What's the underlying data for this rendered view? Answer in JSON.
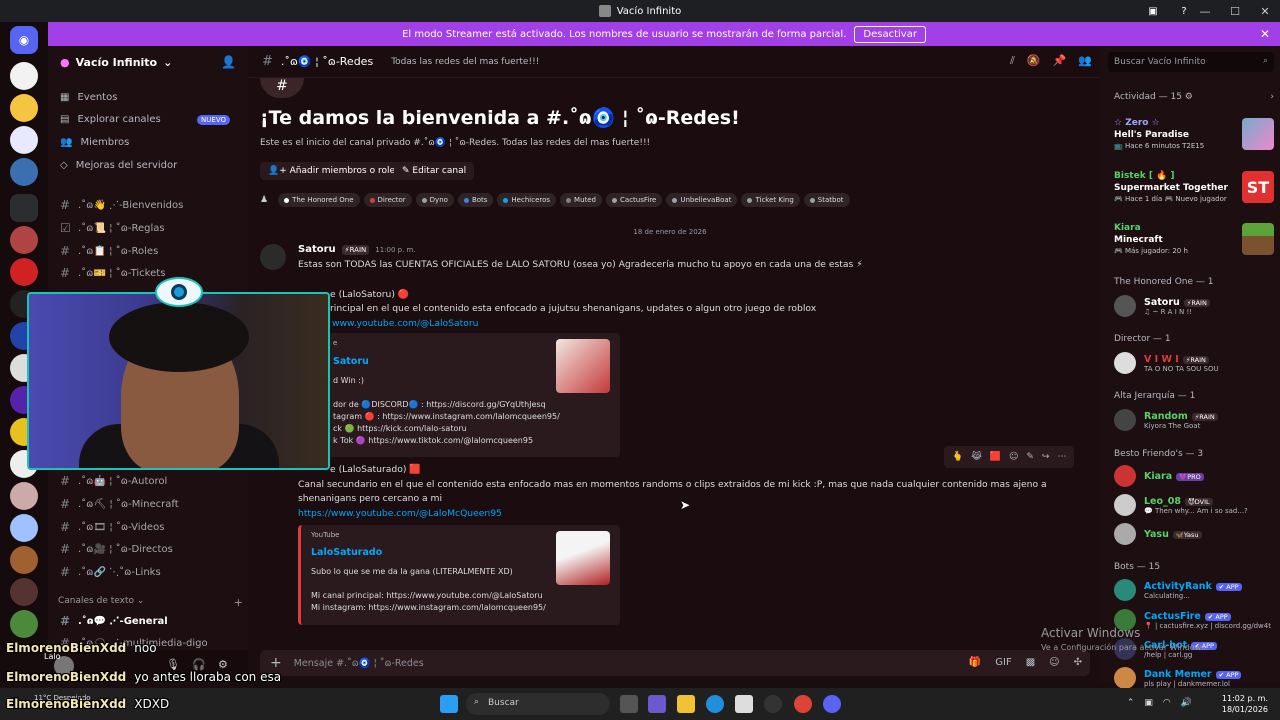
{
  "window": {
    "title": "Vacío Infinito"
  },
  "banner": {
    "text": "El modo Streamer está activado. Los nombres de usuario se mostrarán de forma parcial.",
    "button": "Desactivar"
  },
  "guild": {
    "name": "Vacío Infinito"
  },
  "nav": [
    {
      "label": "Eventos"
    },
    {
      "label": "Explorar canales",
      "badge": "NUEVO"
    },
    {
      "label": "Miembros"
    },
    {
      "label": "Mejoras del servidor"
    }
  ],
  "channels_top": [
    {
      "label": ".˚ɷ👋 ⋰-Bienvenidos"
    },
    {
      "label": ".˚ɷ📜 ¦ ˚ɷ-Reglas"
    },
    {
      "label": ".˚ɷ📋 ¦ ˚ɷ-Roles"
    },
    {
      "label": ".˚ɷ🎫 ¦ ˚ɷ-Tickets"
    }
  ],
  "channels_mid": [
    {
      "label": ".˚ɷ🤖 ¦ ˚ɷ-Autorol"
    },
    {
      "label": ".˚ɷ⛏ ¦ ˚ɷ-Minecraft"
    },
    {
      "label": ".˚ɷ🎞 ¦ ˚ɷ-Videos"
    },
    {
      "label": ".˚ɷ🎥 ¦ ˚ɷ-Directos"
    },
    {
      "label": ".˚ɷ🔗 ⋱˚ɷ-Links"
    }
  ],
  "category_text": "Canales de texto",
  "channel_general": ".˚ɷ💬 ⋰-General",
  "channel_partial": ".˚ɷ🗨 ⋰-multimiedia-digo",
  "header": {
    "channel": ".˚ɷ🧿 ¦ ˚ɷ-Redes",
    "topic": "Todas las redes del mas fuerte!!!"
  },
  "welcome": {
    "title": "¡Te damos la bienvenida a #.˚ɷ🧿 ¦ ˚ɷ-Redes!",
    "subtitle": "Este es el inicio del canal privado #.˚ɷ🧿 ¦ ˚ɷ-Redes. Todas las redes del mas fuerte!!!",
    "add_button": "Añadir miembros o roles",
    "edit_button": "Editar canal"
  },
  "roles": [
    {
      "label": "The Honored One",
      "color": "#ffffff"
    },
    {
      "label": "Director",
      "color": "#e23b3b"
    },
    {
      "label": "Dyno",
      "color": "#9aa0a6"
    },
    {
      "label": "Bots",
      "color": "#3b82f6"
    },
    {
      "label": "Hechiceros",
      "color": "#00a8fc"
    },
    {
      "label": "Muted",
      "color": "#818181"
    },
    {
      "label": "CactusFire",
      "color": "#9aa0a6"
    },
    {
      "label": "UnbelievaBoat",
      "color": "#9aa0a6"
    },
    {
      "label": "Ticket King",
      "color": "#9aa0a6"
    },
    {
      "label": "Statbot",
      "color": "#9aa0a6"
    }
  ],
  "date_divider": "18 de enero de 2026",
  "message": {
    "author": "Satoru",
    "tag": "⚡RAIN",
    "time": "11:00 p. m.",
    "line1": "Estas son TODAS las CUENTAS OFICIALES de LALO SATORU (osea yo) Agradecería mucho tu apoyo en cada una de estas ⚡",
    "l2": "e (LaloSatoru) 🔴",
    "l3": "rincipal en el que el contenido esta enfocado a jujutsu shenanigans, updates o algun otro juego de roblox",
    "link1": "www.youtube.com/@LaloSatoru",
    "embed1": {
      "provider": "e",
      "title": "Satoru",
      "d1": "d Win :)",
      "d2": "dor de 🔵DISCORD🔵 : https://discord.gg/GYqUthJesq",
      "d3": "tagram 🔴 : https://www.instagram.com/lalomcqueen95/",
      "d4": "ck 🟢 https://kick.com/lalo-satoru",
      "d5": "k Tok 🟣 https://www.tiktok.com/@lalomcqueen95"
    },
    "l4": "e (LaloSaturado) 🟥",
    "l5": "Canal secundario en el que el contenido esta enfocado mas en momentos randoms o clips extraidos de mi kick :P, mas que nada cualquier contenido mas ajeno a",
    "l6": "shenanigans pero cercano a mi",
    "link2": "https://www.youtube.com/@LaloMcQueen95",
    "embed2": {
      "provider": "YouTube",
      "title": "LaloSaturado",
      "d1": "Subo lo que se me da la gana (LITERALMENTE XD)",
      "d2": "Mi canal principal: https://www.youtube.com/@LaloSatoru",
      "d3": "Mi instagram: https://www.instagram.com/lalomcqueen95/"
    }
  },
  "composer": {
    "placeholder": "Mensaje #.˚ɷ🧿 ¦ ˚ɷ-Redes"
  },
  "search": {
    "placeholder": "Buscar Vacío Infinito"
  },
  "activity": {
    "header": "Actividad — 15 ⚙",
    "items": [
      {
        "name": "☆ Zero ☆",
        "game": "Hell's Paradise",
        "status": "📺 Hace 6 minutos  T2E15",
        "color": "#a0a8ff"
      },
      {
        "name": "Bistek [ 🔥 ]",
        "game": "Supermarket Together",
        "status": "🎮 Hace 1 día  🎮 Nuevo jugador",
        "color": "#58d36a"
      },
      {
        "name": "Kiara",
        "game": "Minecraft",
        "status": "🎮 Más jugador: 20 h",
        "color": "#58d36a"
      }
    ]
  },
  "groups": [
    {
      "header": "The Honored One — 1",
      "members": [
        {
          "name": "Satoru",
          "tag": "⚡RAIN",
          "status": "♫ ~ R A I N !!",
          "color": "#ffffff"
        }
      ]
    },
    {
      "header": "Director — 1",
      "members": [
        {
          "name": "V I W I",
          "tag": "⚡RAIN",
          "status": "TA O NO TA SOU SOU",
          "color": "#e23b3b"
        }
      ]
    },
    {
      "header": "Alta Jerarquía — 1",
      "members": [
        {
          "name": "Random",
          "tag": "⚡RAIN",
          "status": "Kiyora The Goat",
          "color": "#58d36a"
        }
      ]
    },
    {
      "header": "Besto Friendo's — 3",
      "members": [
        {
          "name": "Kiara",
          "tag": "💜PRO",
          "status": "",
          "color": "#58d36a"
        },
        {
          "name": "Leo_08",
          "tag": "😈DVIL",
          "status": "💬 Then why... Am i so sad...?",
          "color": "#58d36a"
        },
        {
          "name": "Yasu",
          "tag": "🦋Yasu",
          "status": "",
          "color": "#58d36a"
        }
      ]
    },
    {
      "header": "Bots — 15",
      "members": [
        {
          "name": "ActivityRank",
          "tag": "✔ APP",
          "status": "Calculating...",
          "color": "#00a8fc"
        },
        {
          "name": "CactusFire",
          "tag": "✔ APP",
          "status": "📍 | cactusfire.xyz | discord.gg/dw4t",
          "color": "#00a8fc"
        },
        {
          "name": "Carl-bot",
          "tag": "✔ APP",
          "status": "/help | carl.gg",
          "color": "#00a8fc"
        },
        {
          "name": "Dank Memer",
          "tag": "✔ APP",
          "status": "pls play | dankmemer.lol",
          "color": "#00a8fc"
        }
      ]
    }
  ],
  "stream_chat": [
    {
      "user": "ElmorenoBienXdd",
      "text": "noo"
    },
    {
      "user": "ElmorenoBienXdd",
      "text": "yo antes lloraba con esa"
    },
    {
      "user": "ElmorenoBienXdd",
      "text": "XDXD"
    }
  ],
  "user_panel": {
    "name": "Lalo"
  },
  "watermark": {
    "line1": "Activar Windows",
    "line2": "Ve a Configuración para activar Windows."
  },
  "taskbar": {
    "search": "Buscar",
    "time": "11:02 p. m.",
    "date": "18/01/2026",
    "weather": "11°C  Despejado"
  }
}
